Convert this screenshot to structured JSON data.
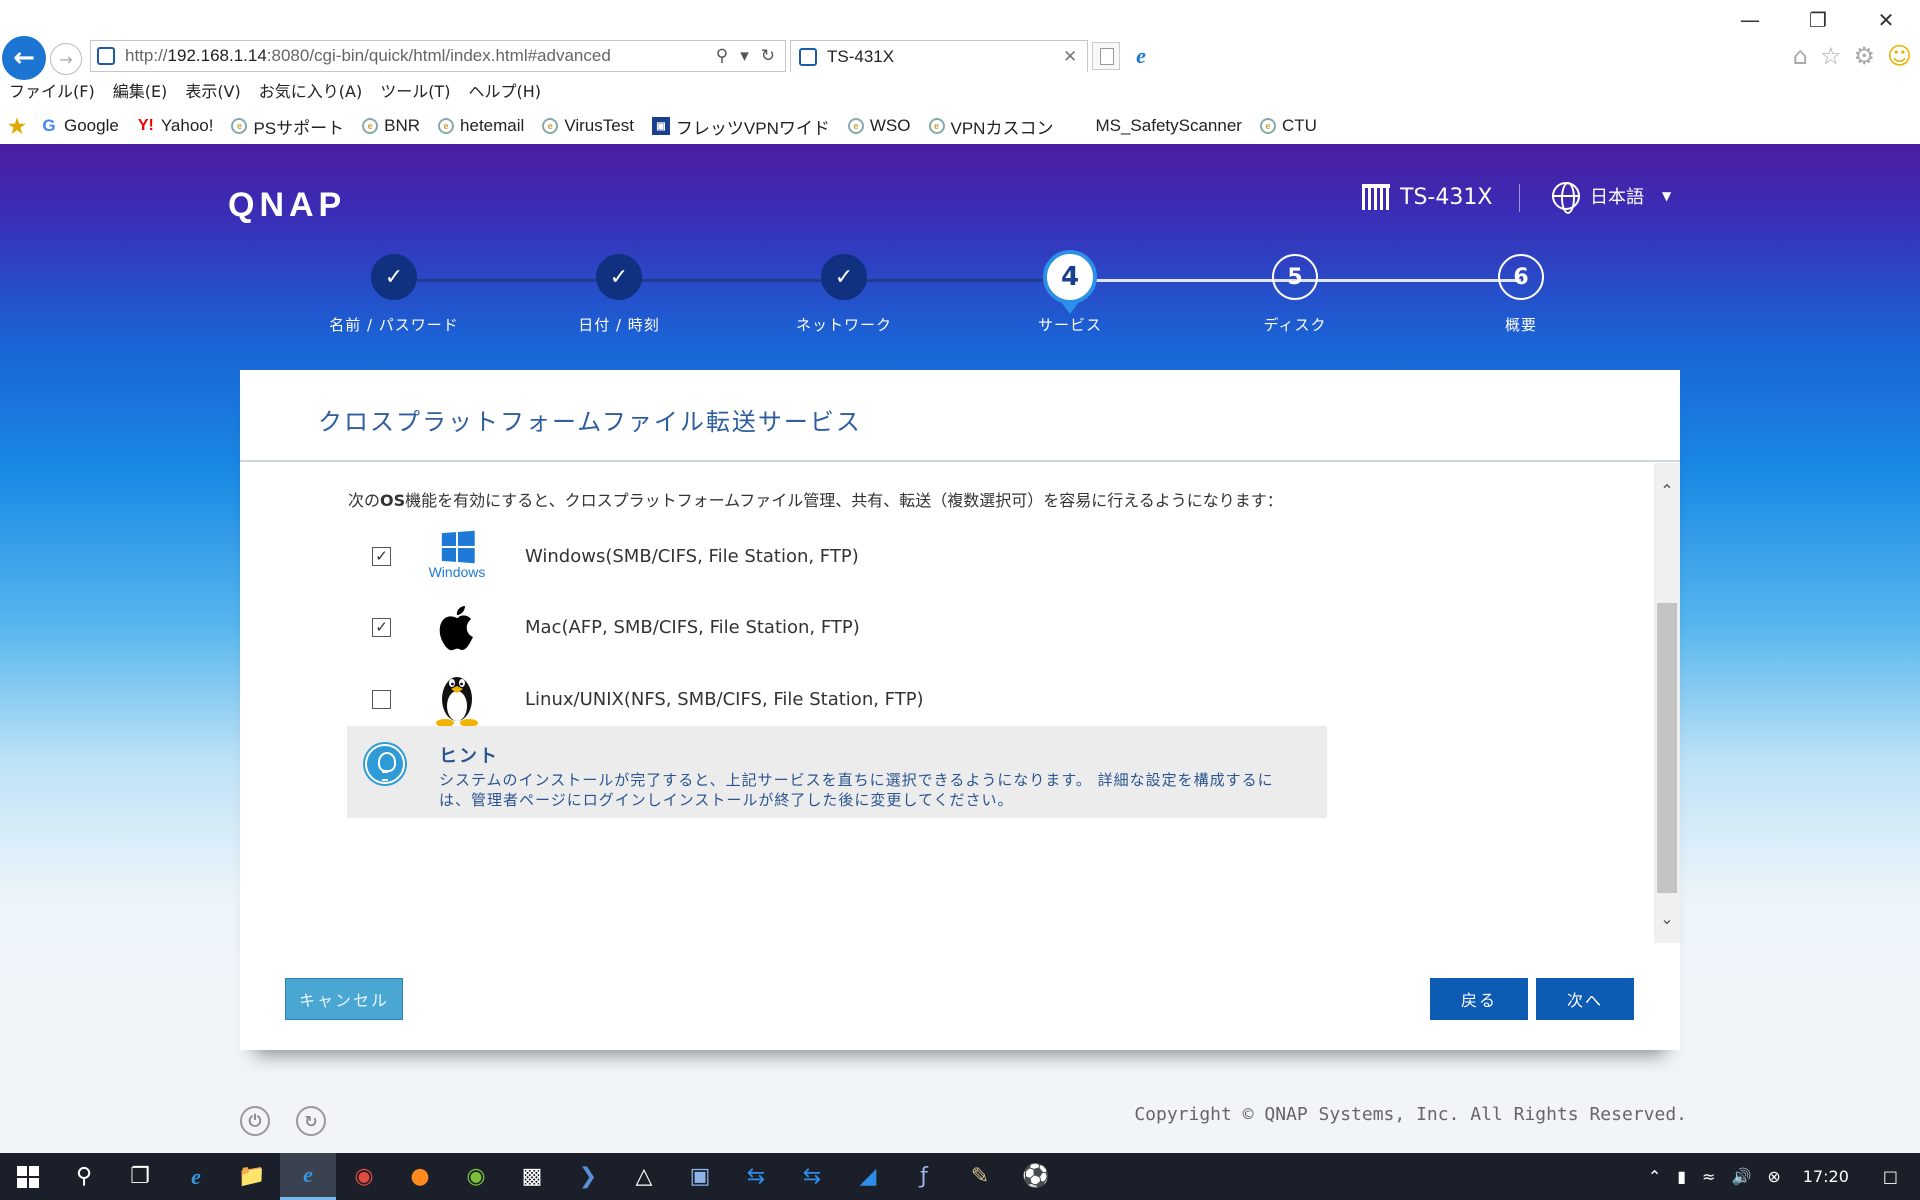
{
  "browser": {
    "url_prefix": "http://",
    "url_host": "192.168.1.14",
    "url_rest": ":8080/cgi-bin/quick/html/index.html#advanced",
    "tab_title": "TS-431X",
    "menu": [
      "ファイル(F)",
      "編集(E)",
      "表示(V)",
      "お気に入り(A)",
      "ツール(T)",
      "ヘルプ(H)"
    ],
    "favorites": [
      "Google",
      "Yahoo!",
      "PSサポート",
      "BNR",
      "hetemail",
      "VirusTest",
      "フレッツVPNワイド",
      "WSO",
      "VPNカスコン",
      "MS_SafetyScanner",
      "CTU"
    ]
  },
  "header": {
    "logo": "QNAP",
    "model": "TS-431X",
    "language": "日本語"
  },
  "steps": [
    {
      "number": "✓",
      "label": "名前 / パスワード",
      "state": "done"
    },
    {
      "number": "✓",
      "label": "日付 / 時刻",
      "state": "done"
    },
    {
      "number": "✓",
      "label": "ネットワーク",
      "state": "done"
    },
    {
      "number": "4",
      "label": "サービス",
      "state": "active"
    },
    {
      "number": "5",
      "label": "ディスク",
      "state": "todo"
    },
    {
      "number": "6",
      "label": "概要",
      "state": "todo"
    }
  ],
  "card": {
    "title": "クロスプラットフォームファイル転送サービス",
    "intro_pre": "次の",
    "intro_os": "OS",
    "intro_post": "機能を有効にすると、クロスプラットフォームファイル管理、共有、転送（複数選択可）を容易に行えるようになります：",
    "options": [
      {
        "name": "Windows(SMB/CIFS, File Station, FTP)",
        "checked": true,
        "logo_text": "Windows"
      },
      {
        "name": "Mac(AFP, SMB/CIFS, File Station, FTP)",
        "checked": true
      },
      {
        "name": "Linux/UNIX(NFS, SMB/CIFS, File Station, FTP)",
        "checked": false
      }
    ],
    "hint_title": "ヒント",
    "hint_text": "システムのインストールが完了すると、上記サービスを直ちに選択できるようになります。 詳細な設定を構成するには、管理者ページにログインしインストールが終了した後に変更してください。",
    "cancel_label": "キャンセル",
    "back_label": "戻る",
    "next_label": "次へ"
  },
  "footer": {
    "copyright": "Copyright © QNAP Systems, Inc. All Rights Reserved."
  },
  "taskbar": {
    "clock": "17:20"
  },
  "colors": {
    "accent_blue": "#0e5bb3",
    "cancel_button": "#4aa7d3",
    "title_blue": "#2f5e9f"
  }
}
